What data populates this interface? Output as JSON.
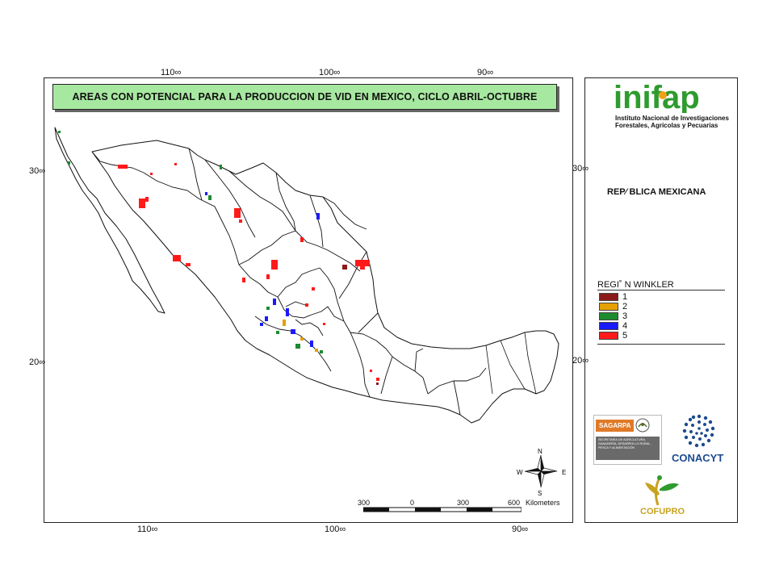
{
  "title": "AREAS CON POTENCIAL PARA LA PRODUCCION DE VID EN MEXICO, CICLO ABRIL-OCTUBRE",
  "axis_ticks": {
    "top": [
      "110∞",
      "100∞",
      "90∞"
    ],
    "bottom": [
      "110∞",
      "100∞",
      "90∞"
    ],
    "left": [
      "30∞",
      "20∞"
    ],
    "right": [
      "30∞",
      "20∞"
    ]
  },
  "institute": {
    "logo_text": "inifap",
    "name_line1": "Instituto Nacional de Investigaciones",
    "name_line2": "Forestales, Agrícolas y Pecuarias"
  },
  "country_label": "REP⁄ BLICA MEXICANA",
  "legend": {
    "title": "REGI˚ N WINKLER",
    "items": [
      {
        "label": "1",
        "color": "#8b1a1a"
      },
      {
        "label": "2",
        "color": "#e5a000"
      },
      {
        "label": "3",
        "color": "#1e8a2e"
      },
      {
        "label": "4",
        "color": "#1a1aff"
      },
      {
        "label": "5",
        "color": "#ff1a1a"
      }
    ]
  },
  "compass": {
    "n": "N",
    "s": "S",
    "e": "E",
    "w": "W"
  },
  "scale": {
    "labels": [
      "300",
      "0",
      "300",
      "600"
    ],
    "unit": "Kilometers"
  },
  "logos": {
    "sagarpa": "SAGARPA",
    "sagarpa_sub": "SECRETARÍA DE AGRICULTURA, GANADERÍA, DESARROLLO RURAL, PESCA Y ALIMENTACIÓN",
    "conacyt": "CONACYT",
    "cofupro": "COFUPRO"
  },
  "colors": {
    "title_bg": "#a7e8a0",
    "inifap_green": "#2e9b2e",
    "inifap_orange": "#f0a018"
  }
}
